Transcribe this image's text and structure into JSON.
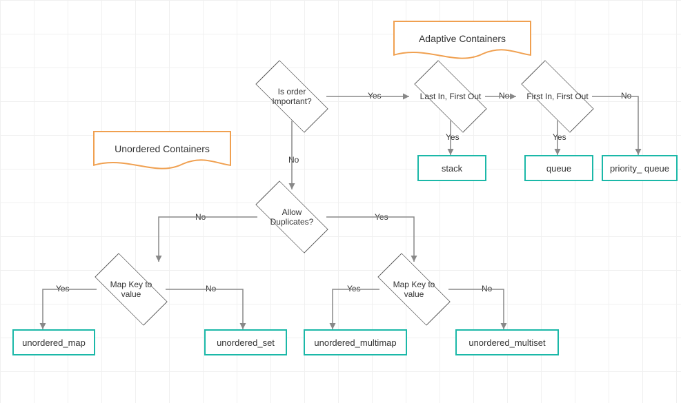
{
  "titles": {
    "adaptive": "Adaptive Containers",
    "unordered": "Unordered Containers"
  },
  "decisions": {
    "orderImportant": "Is order Important?",
    "lifo": "Last In, First Out",
    "fifo": "First In, First Out",
    "allowDup": "Allow Duplicates?",
    "mapKeyLeft": "Map Key to value",
    "mapKeyRight": "Map Key to value"
  },
  "edges": {
    "yes": "Yes",
    "no": "No"
  },
  "terminals": {
    "stack": "stack",
    "queue": "queue",
    "pqueue": "priority_ queue",
    "umap": "unordered_map",
    "uset": "unordered_set",
    "ummap": "unordered_multimap",
    "umset": "unordered_multiset"
  }
}
